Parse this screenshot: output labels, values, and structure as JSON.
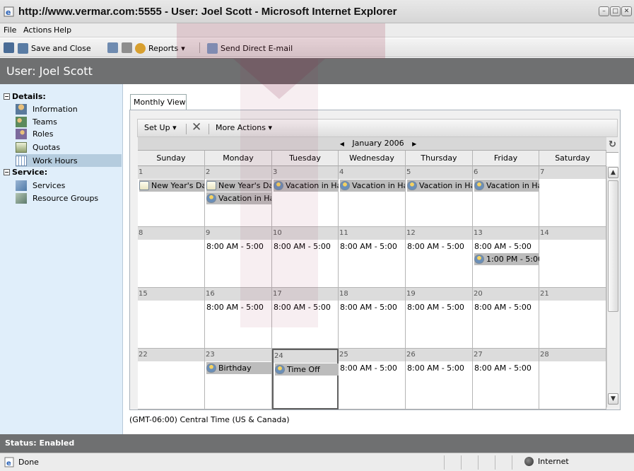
{
  "window": {
    "title": "http://www.vermar.com:5555 - User: Joel Scott - Microsoft Internet Explorer",
    "controls": [
      "minimize",
      "restore",
      "close"
    ]
  },
  "menu": {
    "file": "File",
    "actions": "Actions",
    "help": "Help"
  },
  "toolbar": {
    "save_close": "Save and Close",
    "reports": "Reports",
    "send_email": "Send Direct E-mail"
  },
  "header": {
    "title": "User: Joel Scott"
  },
  "sidebar": {
    "details_heading": "Details:",
    "details_items": [
      {
        "label": "Information",
        "icon": "person-icon"
      },
      {
        "label": "Teams",
        "icon": "team-icon"
      },
      {
        "label": "Roles",
        "icon": "roles-icon"
      },
      {
        "label": "Quotas",
        "icon": "quotas-icon"
      },
      {
        "label": "Work Hours",
        "icon": "calendar-grid-icon",
        "selected": true
      }
    ],
    "service_heading": "Service:",
    "service_items": [
      {
        "label": "Services",
        "icon": "services-icon"
      },
      {
        "label": "Resource Groups",
        "icon": "resource-groups-icon"
      }
    ]
  },
  "tab": {
    "label": "Monthly View"
  },
  "cal_toolbar": {
    "setup": "Set Up",
    "more_actions": "More Actions"
  },
  "calendar": {
    "month": "January 2006",
    "days": [
      "Sunday",
      "Monday",
      "Tuesday",
      "Wednesday",
      "Thursday",
      "Friday",
      "Saturday"
    ],
    "weeks": [
      {
        "dates": [
          "1",
          "2",
          "3",
          "4",
          "5",
          "6",
          "7"
        ],
        "events": [
          [
            {
              "text": "New Year's Da",
              "icon": "note"
            }
          ],
          [
            {
              "text": "New Year's Da",
              "icon": "note"
            },
            {
              "text": "Vacation in Ha",
              "icon": "person"
            }
          ],
          [
            {
              "text": "Vacation in Ha",
              "icon": "person"
            }
          ],
          [
            {
              "text": "Vacation in Ha",
              "icon": "person"
            }
          ],
          [
            {
              "text": "Vacation in Ha",
              "icon": "person"
            }
          ],
          [
            {
              "text": "Vacation in Ha",
              "icon": "person"
            }
          ],
          []
        ]
      },
      {
        "dates": [
          "8",
          "9",
          "10",
          "11",
          "12",
          "13",
          "14"
        ],
        "events": [
          [],
          [
            {
              "text": "8:00 AM - 5:00",
              "icon": "cal"
            }
          ],
          [
            {
              "text": "8:00 AM - 5:00",
              "icon": "cal"
            }
          ],
          [
            {
              "text": "8:00 AM - 5:00",
              "icon": "cal"
            }
          ],
          [
            {
              "text": "8:00 AM - 5:00",
              "icon": "cal"
            }
          ],
          [
            {
              "text": "8:00 AM - 5:00",
              "icon": "cal"
            },
            {
              "text": "1:00 PM - 5:00",
              "icon": "person"
            }
          ],
          []
        ]
      },
      {
        "dates": [
          "15",
          "16",
          "17",
          "18",
          "19",
          "20",
          "21"
        ],
        "events": [
          [],
          [
            {
              "text": "8:00 AM - 5:00",
              "icon": "cal"
            }
          ],
          [
            {
              "text": "8:00 AM - 5:00",
              "icon": "cal"
            }
          ],
          [
            {
              "text": "8:00 AM - 5:00",
              "icon": "cal"
            }
          ],
          [
            {
              "text": "8:00 AM - 5:00",
              "icon": "cal"
            }
          ],
          [
            {
              "text": "8:00 AM - 5:00",
              "icon": "cal"
            }
          ],
          []
        ]
      },
      {
        "dates": [
          "22",
          "23",
          "24",
          "25",
          "26",
          "27",
          "28"
        ],
        "events": [
          [],
          [
            {
              "text": "Birthday",
              "icon": "person"
            }
          ],
          [
            {
              "text": "Time Off",
              "icon": "person"
            }
          ],
          [
            {
              "text": "8:00 AM - 5:00",
              "icon": "cal"
            }
          ],
          [
            {
              "text": "8:00 AM - 5:00",
              "icon": "cal"
            }
          ],
          [
            {
              "text": "8:00 AM - 5:00",
              "icon": "cal"
            }
          ],
          []
        ]
      }
    ],
    "today_date": "24"
  },
  "timezone": "(GMT-06:00) Central Time (US & Canada)",
  "status": {
    "app": "Status: Enabled",
    "browser": "Done",
    "zone": "Internet"
  }
}
